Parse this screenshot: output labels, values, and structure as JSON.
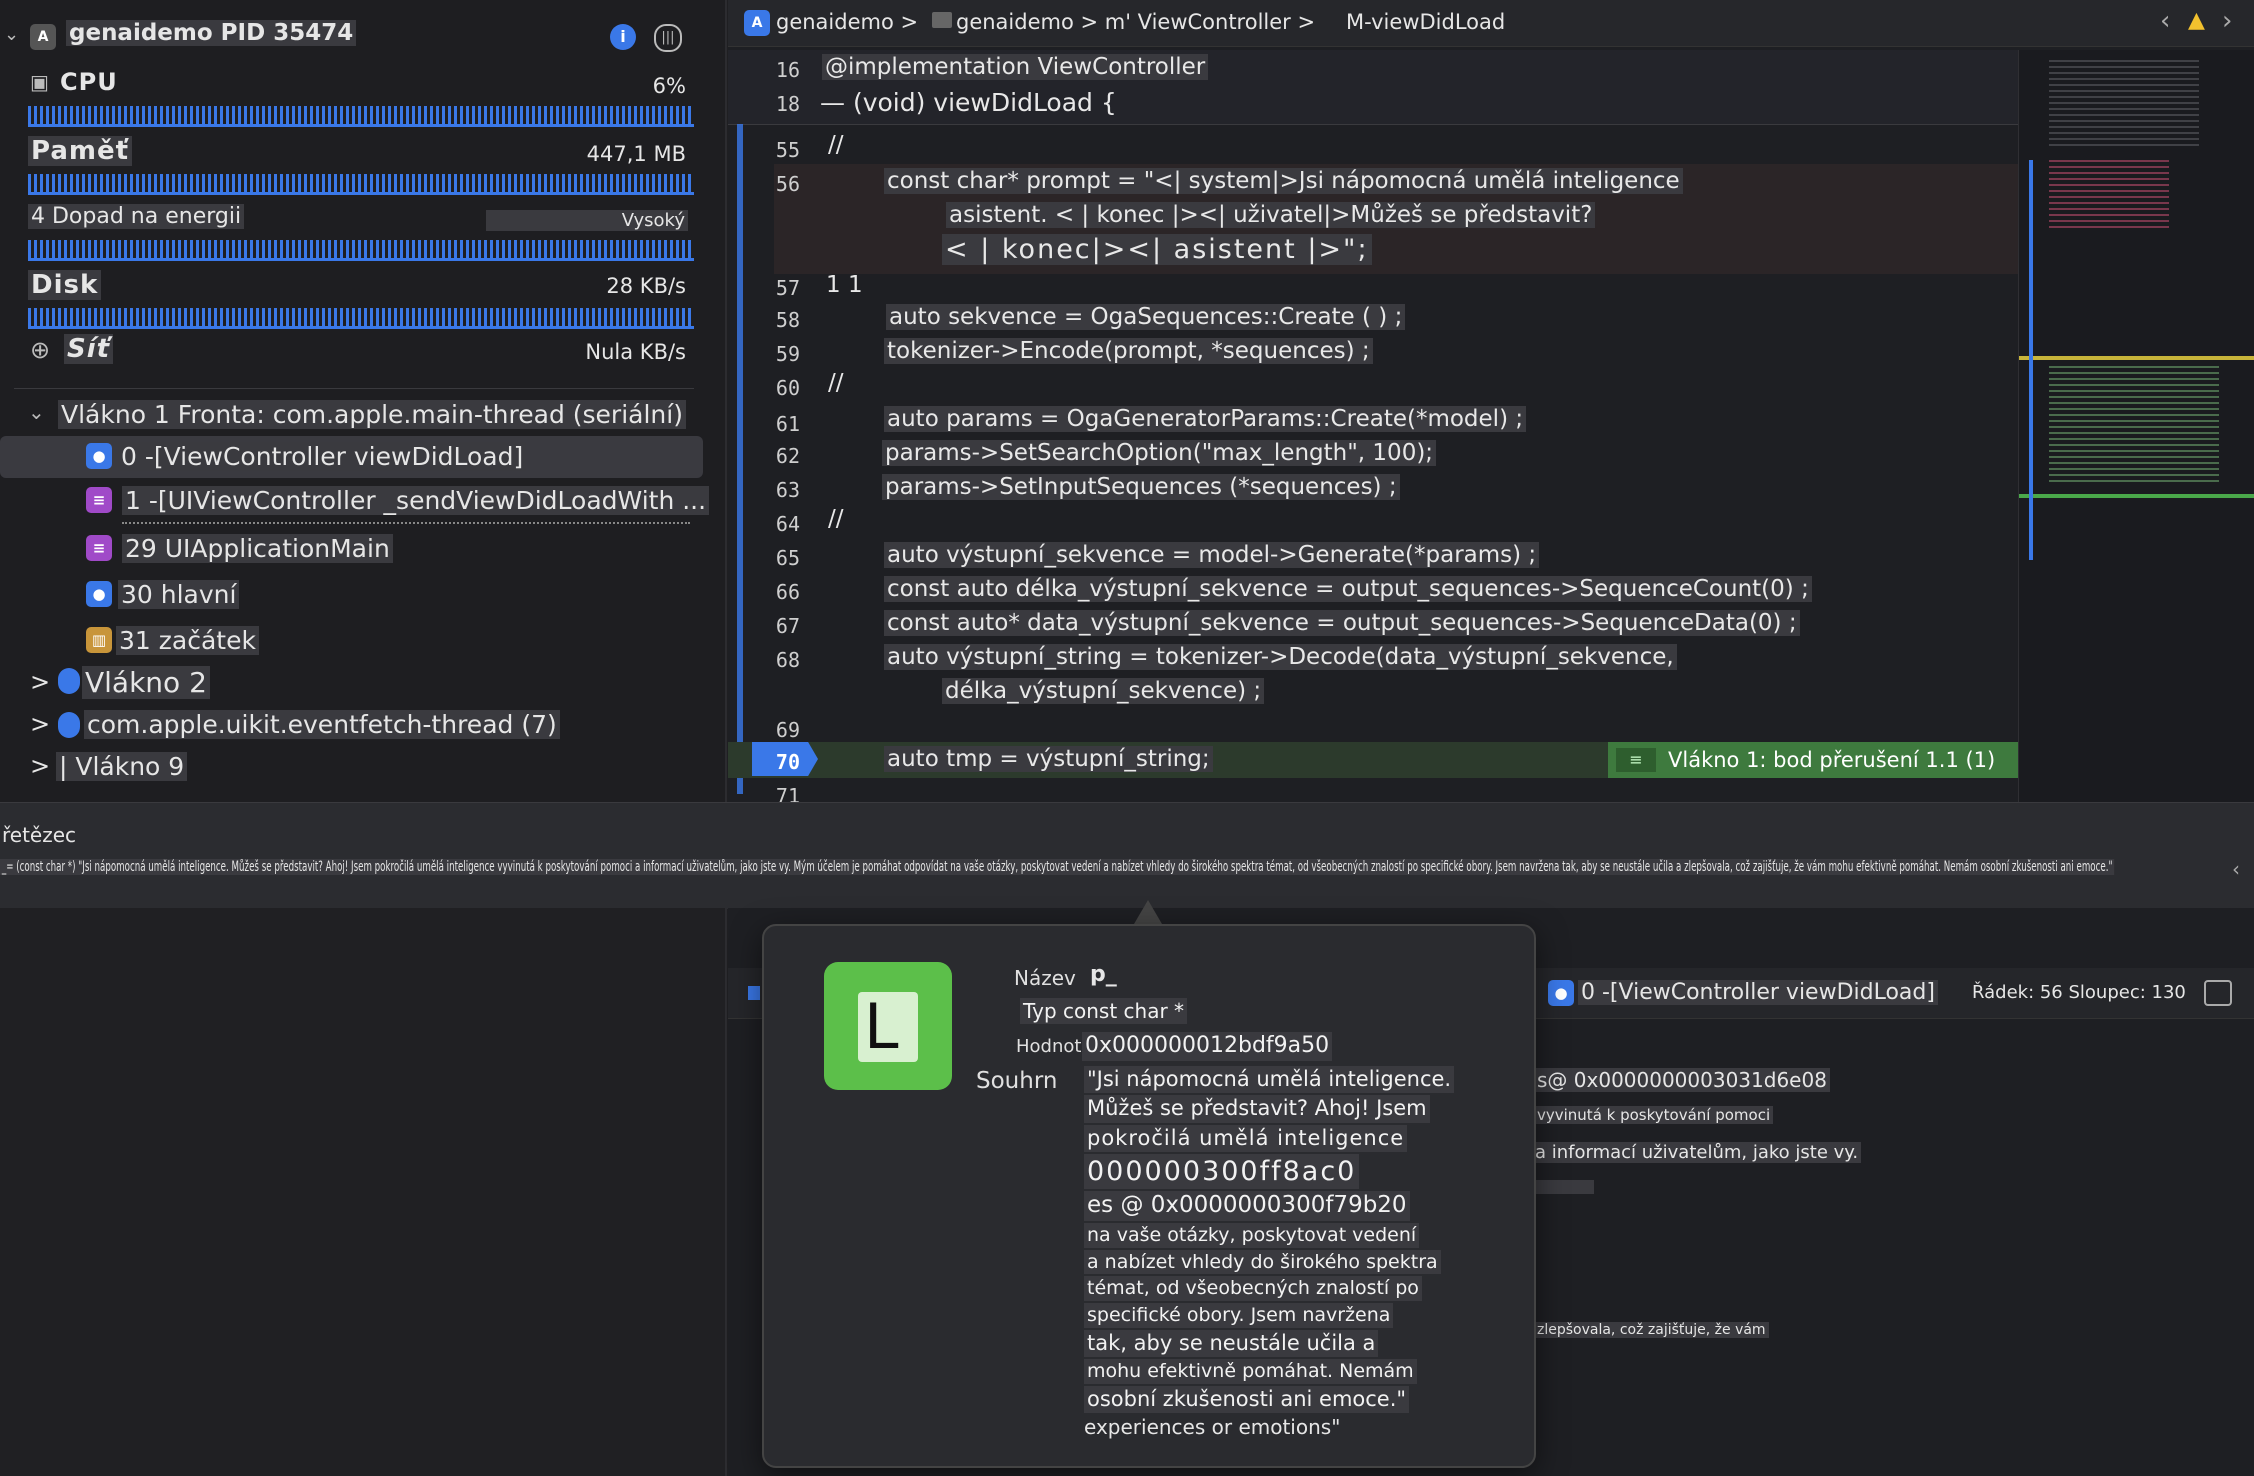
{
  "navigator": {
    "process_title": "genaidemo PID 35474",
    "gauges": [
      {
        "label": "CPU",
        "value": "6%"
      },
      {
        "label": "Paměť",
        "value": "447,1 MB"
      },
      {
        "label": "4 Dopad na energii",
        "value": "Vysoký"
      },
      {
        "label": "Disk",
        "value": "28 KB/s"
      },
      {
        "label": "Síť",
        "value": "Nula KB/s"
      }
    ],
    "threads": {
      "thread1": "Vlákno 1 Fronta: com.apple.main-thread (seriální)",
      "frames": [
        "0 -[ViewController viewDidLoad]",
        "1 -[UIViewController _sendViewDidLoadWith ...",
        "29 UIApplicationMain",
        "30 hlavní",
        "31 začátek"
      ],
      "thread2": "Vlákno 2",
      "eventfetch": "com.apple.uikit.eventfetch-thread (7)",
      "thread9": "| Vlákno 9"
    }
  },
  "jumpbar": {
    "crumb1": "genaidemo >",
    "crumb2": "genaidemo > m' ViewController >",
    "crumb3": "M-viewDidLoad"
  },
  "editor": {
    "sticky": [
      {
        "ln": "16",
        "code": "@implementation ViewController"
      },
      {
        "ln": "18",
        "code": "— (void) viewDidLoad {"
      }
    ],
    "lines": [
      {
        "ln": "55",
        "code": "//"
      },
      {
        "ln": "56",
        "code": "const char* prompt = \"<| system|>Jsi nápomocná umělá inteligence"
      },
      {
        "ln": "",
        "code": "asistent. < | konec |><| uživatel|>Můžeš se představit?"
      },
      {
        "ln": "",
        "code": "< | konec|><| asistent |>\";"
      },
      {
        "ln": "57",
        "code": "1 1"
      },
      {
        "ln": "58",
        "code": "auto sekvence = OgaSequences::Create ( ) ;"
      },
      {
        "ln": "59",
        "code": "tokenizer->Encode(prompt, *sequences) ;"
      },
      {
        "ln": "60",
        "code": "//"
      },
      {
        "ln": "61",
        "code": "auto params = OgaGeneratorParams::Create(*model) ;"
      },
      {
        "ln": "62",
        "code": "params->SetSearchOption(\"max_length\", 100);"
      },
      {
        "ln": "63",
        "code": "params->SetInputSequences (*sequences) ;"
      },
      {
        "ln": "64",
        "code": "//"
      },
      {
        "ln": "65",
        "code": "auto výstupní_sekvence = model->Generate(*params) ;"
      },
      {
        "ln": "66",
        "code": "const auto délka_výstupní_sekvence = output_sequences->SequenceCount(0) ;"
      },
      {
        "ln": "67",
        "code": "const auto* data_výstupní_sekvence = output_sequences->SequenceData(0) ;"
      },
      {
        "ln": "68",
        "code": "auto výstupní_string = tokenizer->Decode(data_výstupní_sekvence,"
      },
      {
        "ln": "",
        "code": "délka_výstupní_sekvence) ;"
      },
      {
        "ln": "69",
        "code": ""
      },
      {
        "ln": "70",
        "code": "auto tmp = výstupní_string;"
      },
      {
        "ln": "71",
        "code": ""
      }
    ],
    "breakpoint_label": "Vlákno 1: bod přerušení 1.1 (1)"
  },
  "varbar": {
    "title": "řetězec",
    "value": "_= (const char *) \"Jsi nápomocná umělá inteligence. Můžeš se představit? Ahoj! Jsem pokročilá umělá inteligence vyvinutá k poskytování pomoci a informací uživatelům, jako jste vy. Mým účelem je pomáhat odpovídat na vaše otázky, poskytovat vedení a nabízet vhledy do širokého spektra témat, od všeobecných znalostí po specifické obory. Jsem navržena tak, aby se neustále učila a zlepšovala, což zajišťuje, že vám mohu efektivně pomáhat. Nemám osobní zkušenosti ani emoce.\""
  },
  "debugbar": {
    "frame": "0 -[ViewController viewDidLoad]",
    "position": "Řádek: 56 Sloupec: 130"
  },
  "console": {
    "line1": "s@ 0x0000000003031d6e08",
    "line2": "vyvinutá k poskytování pomoci",
    "line3": "a informací uživatelům, jako jste vy.",
    "line4": "zlepšovala, což zajišťuje, že vám"
  },
  "popover": {
    "icon_letter": "L",
    "name_key": "Název",
    "name_val": "p_",
    "type_line": "Typ const char *",
    "value_key": "Hodnota",
    "value_val": "0x000000012bdf9a50",
    "summary_key": "Souhrn",
    "summary_lines": [
      "\"Jsi nápomocná umělá inteligence.",
      "Můžeš se představit? Ahoj! Jsem",
      "pokročilá umělá inteligence",
      "000000300ff8ac0",
      "es @ 0x0000000300f79b20",
      "na vaše otázky, poskytovat vedení",
      "a nabízet vhledy do širokého spektra",
      "témat, od všeobecných znalostí po",
      "specifické obory. Jsem navržena",
      "tak, aby se neustále učila a",
      "mohu efektivně pomáhat. Nemám",
      "osobní zkušenosti ani emoce.\"",
      "experiences or emotions\""
    ]
  }
}
